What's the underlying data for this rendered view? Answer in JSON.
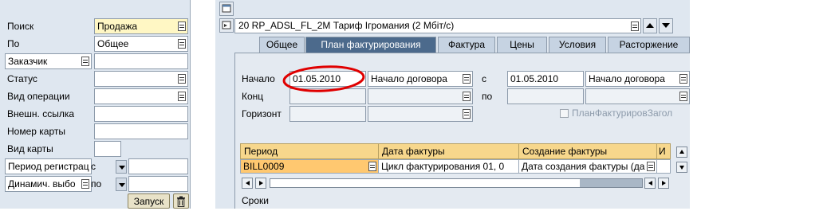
{
  "search_panel": {
    "search_label": "Поиск",
    "search_value": "Продажа",
    "by_label": "По",
    "by_value": "Общее",
    "customer_label": "Заказчик",
    "status_label": "Статус",
    "operation_type_label": "Вид операции",
    "external_ref_label": "Внешн. ссылка",
    "card_number_label": "Номер карты",
    "card_type_label": "Вид карты",
    "reg_period_label": "Период регистрац",
    "reg_period_prefix": "с",
    "dynamic_select_label": "Динамич. выбо",
    "dynamic_select_prefix": "по",
    "start_button": "Запуск"
  },
  "header": {
    "item_selector_value": "20 RP_ADSL_FL_2M Тариф Ігромания (2 Мбіт/с)"
  },
  "tabs": [
    {
      "label": "Общее",
      "active": false
    },
    {
      "label": "План фактурирования",
      "active": true
    },
    {
      "label": "Фактура",
      "active": false
    },
    {
      "label": "Цены",
      "active": false
    },
    {
      "label": "Условия",
      "active": false
    },
    {
      "label": "Расторжение",
      "active": false
    }
  ],
  "billing_plan": {
    "start_label": "Начало",
    "start_date": "01.05.2010",
    "start_rule": "Начало договора",
    "from_label": "с",
    "from_date": "01.05.2010",
    "from_rule": "Начало договора",
    "end_label": "Конц",
    "to_label": "по",
    "horizon_label": "Горизонт",
    "checkbox_label": "ПланФактурировЗагол",
    "footer_label": "Сроки"
  },
  "grid": {
    "columns": [
      "Период",
      "Дата фактуры",
      "Создание фактуры",
      "И"
    ],
    "rows": [
      [
        "BILL0009",
        "Цикл фактурирования 01, 0",
        "Дата создания фактуры (да",
        ""
      ]
    ]
  },
  "colors": {
    "panel_bg": "#dfe7f0",
    "active_tab": "#4c6a8c",
    "grid_header": "#f7d78c",
    "highlight_circle": "#e00000"
  }
}
